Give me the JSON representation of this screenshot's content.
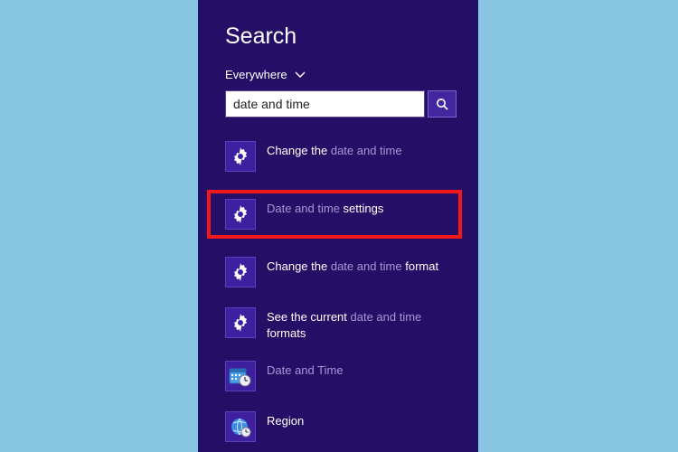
{
  "title": "Search",
  "scope": {
    "label": "Everywhere"
  },
  "search": {
    "value": "date and time"
  },
  "results": [
    {
      "kind": "settings",
      "segments": [
        {
          "text": "Change the ",
          "match": false
        },
        {
          "text": "date and time",
          "match": true
        }
      ]
    },
    {
      "kind": "settings",
      "highlighted": true,
      "segments": [
        {
          "text": "Date and time",
          "match": true
        },
        {
          "text": " settings",
          "match": false
        }
      ]
    },
    {
      "kind": "settings",
      "segments": [
        {
          "text": "Change the ",
          "match": false
        },
        {
          "text": "date and time",
          "match": true
        },
        {
          "text": " format",
          "match": false
        }
      ]
    },
    {
      "kind": "settings",
      "segments": [
        {
          "text": "See the current ",
          "match": false
        },
        {
          "text": "date and time",
          "match": true
        },
        {
          "text": " formats",
          "match": false
        }
      ]
    },
    {
      "kind": "cpl-datetime",
      "segments": [
        {
          "text": "Date and Time",
          "match": true
        }
      ]
    },
    {
      "kind": "cpl-region",
      "segments": [
        {
          "text": "Region",
          "match": false
        }
      ]
    }
  ]
}
